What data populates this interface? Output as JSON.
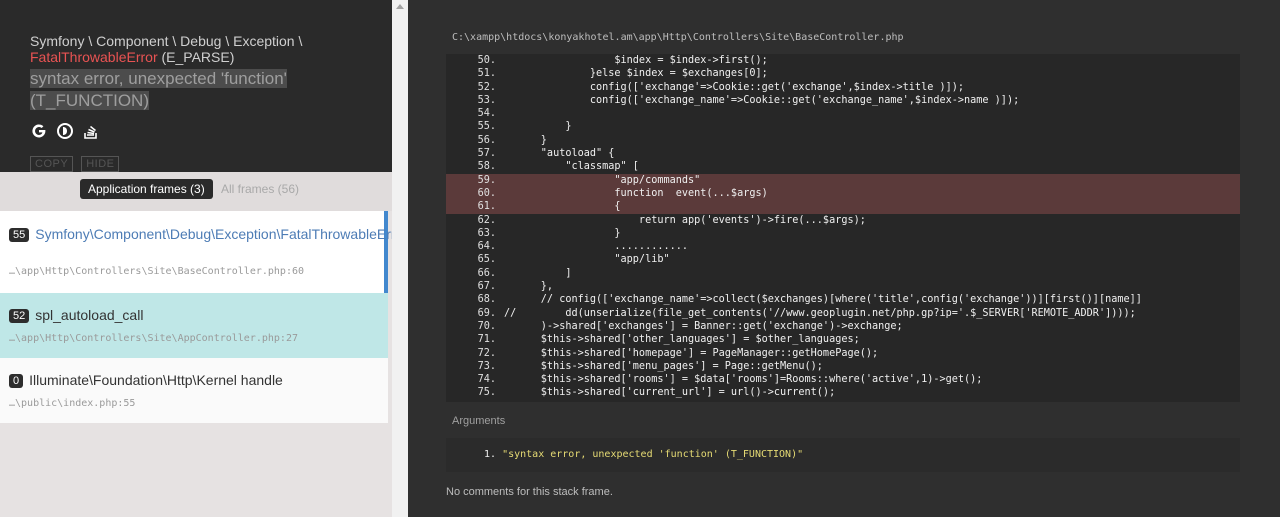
{
  "exception": {
    "namespace": "Symfony \\ Component \\ Debug \\ Exception \\",
    "name": "FatalThrowableError",
    "code": "(E_PARSE)",
    "message": "syntax error, unexpected 'function' (T_FUNCTION)"
  },
  "search_icons": [
    "google-icon",
    "duckduckgo-icon",
    "stackoverflow-icon"
  ],
  "buttons": {
    "copy": "COPY",
    "hide": "HIDE"
  },
  "tabs": {
    "application": "Application frames (3)",
    "all": "All frames (56)"
  },
  "frames": [
    {
      "num": "55",
      "title": "Symfony\\Component\\Debug\\Exception\\FatalThrowableError",
      "path": "…\\app\\Http\\Controllers\\Site\\BaseController.php:60"
    },
    {
      "num": "52",
      "title": "spl_autoload_call",
      "path": "…\\app\\Http\\Controllers\\Site\\AppController.php:27"
    },
    {
      "num": "0",
      "title": "Illuminate\\Foundation\\Http\\Kernel handle",
      "path": "…\\public\\index.php:55"
    }
  ],
  "file_path": "C:\\xampp\\htdocs\\konyakhotel.am\\app\\Http\\Controllers\\Site\\BaseController.php",
  "code_lines": [
    {
      "n": "50.",
      "t": "                  $index = $index->first();"
    },
    {
      "n": "51.",
      "t": "              }else $index = $exchanges[0];"
    },
    {
      "n": "52.",
      "t": "              config(['exchange'=>Cookie::get('exchange',$index->title )]);"
    },
    {
      "n": "53.",
      "t": "              config(['exchange_name'=>Cookie::get('exchange_name',$index->name )]);"
    },
    {
      "n": "54.",
      "t": ""
    },
    {
      "n": "55.",
      "t": "          }"
    },
    {
      "n": "56.",
      "t": "      }"
    },
    {
      "n": "57.",
      "t": "      \"autoload\" {"
    },
    {
      "n": "58.",
      "t": "          \"classmap\" ["
    },
    {
      "n": "59.",
      "t": "                  \"app/commands\"",
      "hl": true
    },
    {
      "n": "60.",
      "t": "                  function  event(...$args)",
      "hl": true
    },
    {
      "n": "61.",
      "t": "                  {",
      "hl": true
    },
    {
      "n": "62.",
      "t": "                      return app('events')->fire(...$args);"
    },
    {
      "n": "63.",
      "t": "                  }"
    },
    {
      "n": "64.",
      "t": "                  ............"
    },
    {
      "n": "65.",
      "t": "                  \"app/lib\""
    },
    {
      "n": "66.",
      "t": "          ]"
    },
    {
      "n": "67.",
      "t": "      },"
    },
    {
      "n": "68.",
      "t": "      // config(['exchange_name'=>collect($exchanges)[where('title',config('exchange'))][first()][name]]"
    },
    {
      "n": "69.",
      "t": "//        dd(unserialize(file_get_contents('//www.geoplugin.net/php.gp?ip='.$_SERVER['REMOTE_ADDR'])));"
    },
    {
      "n": "70.",
      "t": "      )->shared['exchanges'] = Banner::get('exchange')->exchange;"
    },
    {
      "n": "71.",
      "t": "      $this->shared['other_languages'] = $other_languages;"
    },
    {
      "n": "72.",
      "t": "      $this->shared['homepage'] = PageManager::getHomePage();"
    },
    {
      "n": "73.",
      "t": "      $this->shared['menu_pages'] = Page::getMenu();"
    },
    {
      "n": "74.",
      "t": "      $this->shared['rooms'] = $data['rooms']=Rooms::where('active',1)->get();"
    },
    {
      "n": "75.",
      "t": "      $this->shared['current_url'] = url()->current();"
    }
  ],
  "arguments_label": "Arguments",
  "arguments": [
    {
      "index": "1.",
      "value": "\"syntax error, unexpected 'function' (T_FUNCTION)\""
    }
  ],
  "no_comments": "No comments for this stack frame."
}
